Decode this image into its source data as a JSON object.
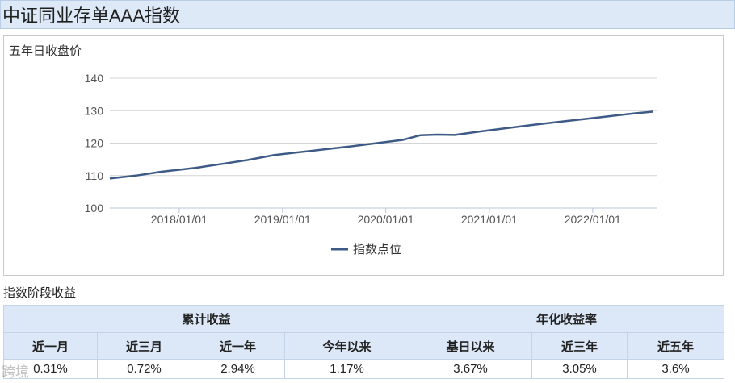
{
  "page_title": "中证同业存单AAA指数",
  "chart": {
    "title": "五年日收盘价"
  },
  "chart_data": {
    "type": "line",
    "title": "五年日收盘价",
    "ylim": [
      100,
      140
    ],
    "y_ticks": [
      "100",
      "110",
      "120",
      "130",
      "140"
    ],
    "x_ticks": [
      "2018/01/01",
      "2019/01/01",
      "2020/01/01",
      "2021/01/01",
      "2022/01/01"
    ],
    "series": [
      {
        "name": "指数点位",
        "color": "#3d5b86",
        "points": [
          [
            "2017/05",
            109.1
          ],
          [
            "2017/08",
            110.0
          ],
          [
            "2017/11",
            111.2
          ],
          [
            "2018/01",
            111.8
          ],
          [
            "2018/03",
            112.4
          ],
          [
            "2018/06",
            113.6
          ],
          [
            "2018/09",
            114.8
          ],
          [
            "2018/12",
            116.3
          ],
          [
            "2019/03",
            117.2
          ],
          [
            "2019/06",
            118.1
          ],
          [
            "2019/09",
            119.0
          ],
          [
            "2019/12",
            120.0
          ],
          [
            "2020/03",
            121.0
          ],
          [
            "2020/05",
            122.4
          ],
          [
            "2020/07",
            122.6
          ],
          [
            "2020/09",
            122.5
          ],
          [
            "2020/12",
            123.6
          ],
          [
            "2021/03",
            124.6
          ],
          [
            "2021/06",
            125.6
          ],
          [
            "2021/09",
            126.5
          ],
          [
            "2021/12",
            127.4
          ],
          [
            "2022/03",
            128.3
          ],
          [
            "2022/06",
            129.2
          ],
          [
            "2022/08",
            129.7
          ]
        ]
      }
    ],
    "legend": "bottom-center",
    "grid": true
  },
  "section_title": "指数阶段收益",
  "table": {
    "groups": [
      "累计收益",
      "年化收益率"
    ],
    "columns": [
      "近一月",
      "近三月",
      "近一年",
      "今年以来",
      "基日以来",
      "近三年",
      "近五年"
    ],
    "row": [
      "0.31%",
      "0.72%",
      "2.94%",
      "1.17%",
      "3.67%",
      "3.05%",
      "3.6%"
    ]
  },
  "watermark": "跨境"
}
